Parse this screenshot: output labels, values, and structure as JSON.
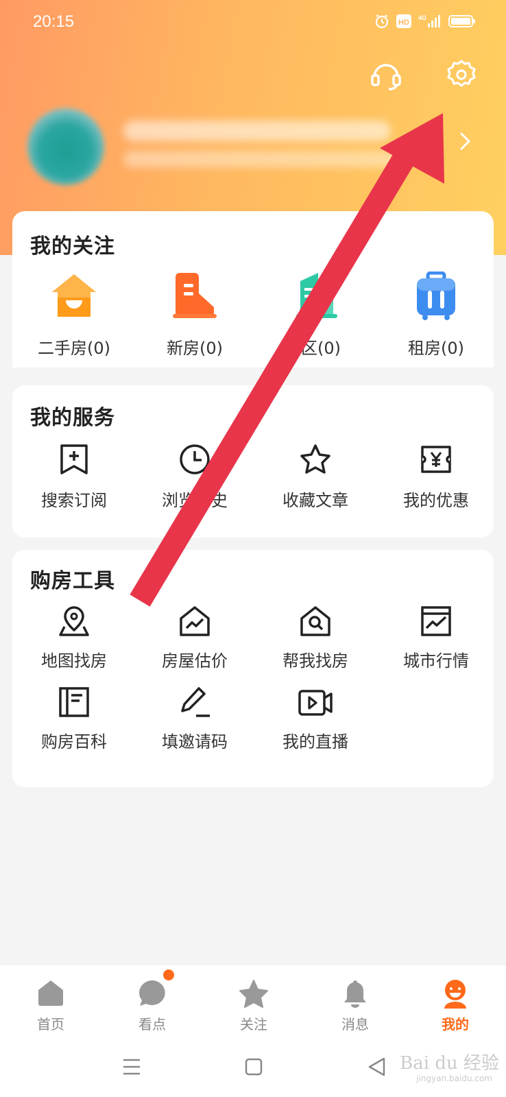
{
  "status_bar": {
    "time": "20:15",
    "icons": [
      "alarm-icon",
      "hd-icon",
      "signal-4g-icon",
      "battery-icon"
    ]
  },
  "header": {
    "support_icon": "headset-icon",
    "settings_icon": "gear-icon",
    "chevron_icon": "chevron-right-icon"
  },
  "follow": {
    "title": "我的关注",
    "items": [
      {
        "label": "二手房(0)",
        "icon": "house-icon",
        "color": "#ff9a1a"
      },
      {
        "label": "新房(0)",
        "icon": "building-icon",
        "color": "#ff6a2a"
      },
      {
        "label": "区(0)",
        "icon": "community-icon",
        "color": "#2ec9a5"
      },
      {
        "label": "租房(0)",
        "icon": "luggage-icon",
        "color": "#3d8cf0"
      }
    ]
  },
  "services": {
    "title": "我的服务",
    "items": [
      {
        "label": "搜索订阅",
        "icon": "bookmark-plus-icon"
      },
      {
        "label": "浏览历史",
        "icon": "clock-icon"
      },
      {
        "label": "收藏文章",
        "icon": "star-icon"
      },
      {
        "label": "我的优惠",
        "icon": "yen-ticket-icon"
      }
    ]
  },
  "tools": {
    "title": "购房工具",
    "items": [
      {
        "label": "地图找房",
        "icon": "map-pin-icon"
      },
      {
        "label": "房屋估价",
        "icon": "house-trend-icon"
      },
      {
        "label": "帮我找房",
        "icon": "house-search-icon"
      },
      {
        "label": "城市行情",
        "icon": "chart-window-icon"
      },
      {
        "label": "购房百科",
        "icon": "book-icon"
      },
      {
        "label": "填邀请码",
        "icon": "pencil-icon"
      },
      {
        "label": "我的直播",
        "icon": "video-icon"
      }
    ]
  },
  "tabbar": {
    "tabs": [
      {
        "label": "首页",
        "icon": "home-icon",
        "active": false
      },
      {
        "label": "看点",
        "icon": "chat-bubble-icon",
        "active": false
      },
      {
        "label": "关注",
        "icon": "star-filled-icon",
        "active": false
      },
      {
        "label": "消息",
        "icon": "bell-icon",
        "active": false
      },
      {
        "label": "我的",
        "icon": "profile-face-icon",
        "active": true
      }
    ],
    "active_color": "#ff6a1a"
  },
  "system_nav": {
    "icons": [
      "menu-icon",
      "home-square-icon",
      "back-triangle-icon"
    ]
  },
  "watermark": {
    "text": "Bai du 经验",
    "sub": "jingyan.baidu.com"
  },
  "annotation": {
    "color": "#e8354a"
  }
}
